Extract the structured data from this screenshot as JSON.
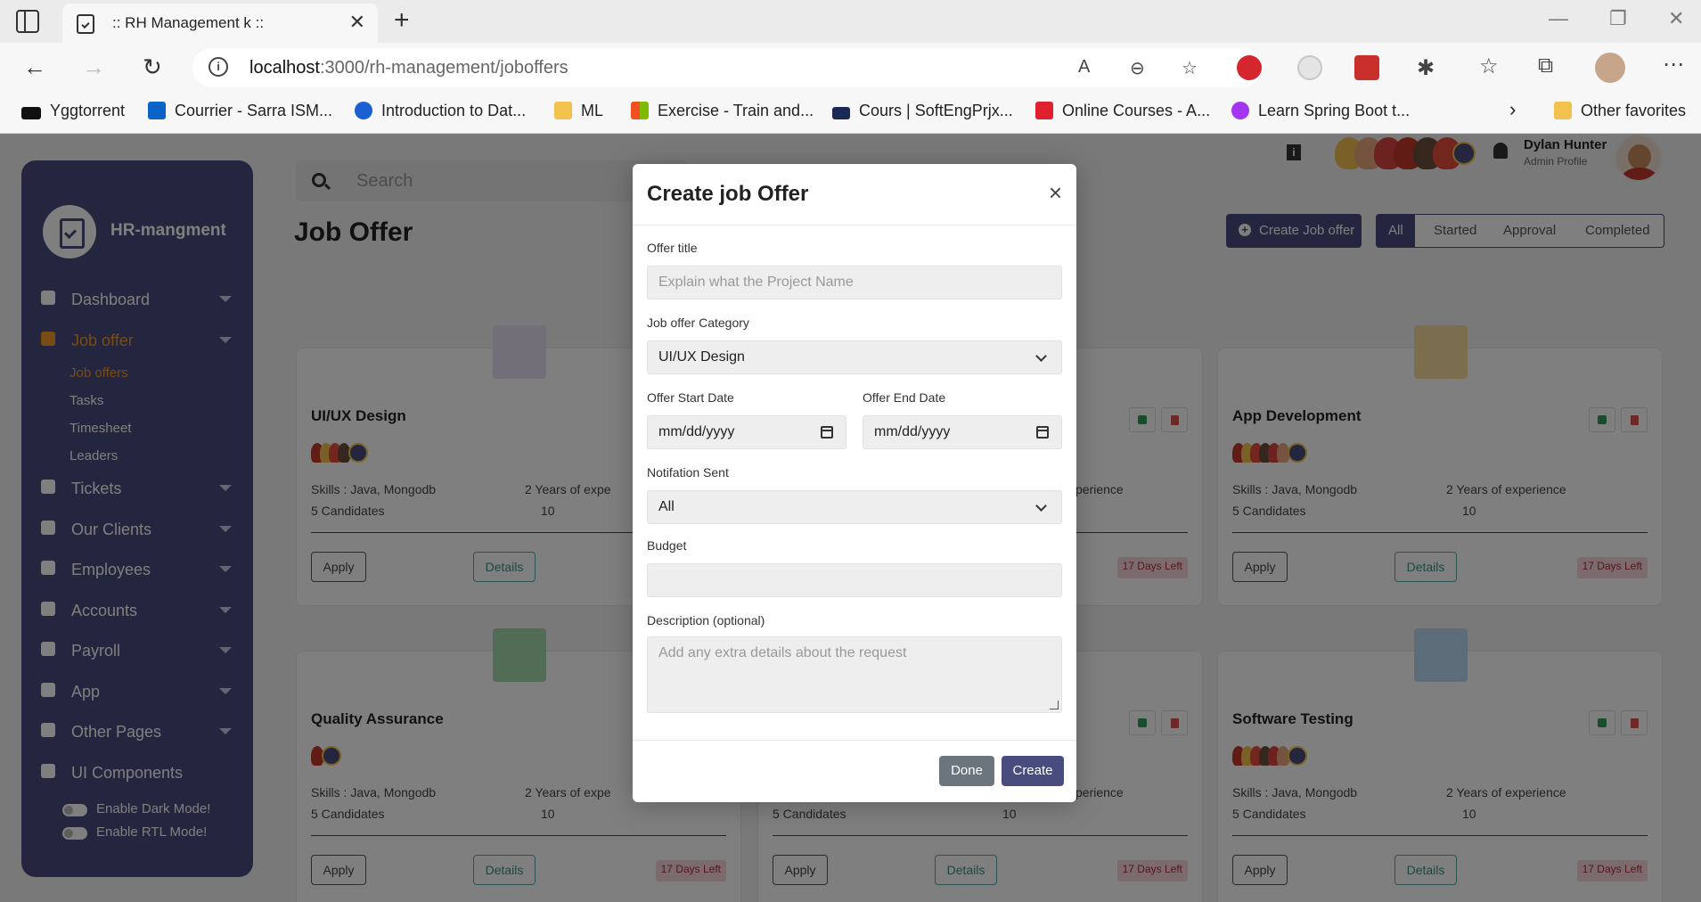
{
  "browser": {
    "tab_title": ":: RH Management k ::",
    "tab_close": "✕",
    "new_tab": "+",
    "url_host": "localhost",
    "url_path": ":3000/rh-management/joboffers",
    "bookmarks": [
      {
        "label": "Yggtorrent",
        "color": "#111111"
      },
      {
        "label": "Courrier - Sarra ISM...",
        "color": "#0a64c8"
      },
      {
        "label": "Introduction to Dat...",
        "color": "#1a5fd1"
      },
      {
        "label": "ML",
        "color": "#f2c14e"
      },
      {
        "label": "Exercise - Train and...",
        "color": "#f25022"
      },
      {
        "label": "Cours | SoftEngPrjx...",
        "color": "#1b2a55"
      },
      {
        "label": "Online Courses - A...",
        "color": "#e0202e"
      },
      {
        "label": "Learn Spring Boot t...",
        "color": "#a435f0"
      }
    ],
    "other_favorites": "Other favorites"
  },
  "sidebar": {
    "brand": "HR-mangment",
    "menu": [
      {
        "label": "Dashboard",
        "active": false
      },
      {
        "label": "Job offer",
        "active": true
      },
      {
        "label": "Tickets",
        "active": false
      },
      {
        "label": "Our Clients",
        "active": false
      },
      {
        "label": "Employees",
        "active": false
      },
      {
        "label": "Accounts",
        "active": false
      },
      {
        "label": "Payroll",
        "active": false
      },
      {
        "label": "App",
        "active": false
      },
      {
        "label": "Other Pages",
        "active": false
      },
      {
        "label": "UI Components",
        "active": false
      }
    ],
    "submenu": [
      {
        "label": "Job offers",
        "active": true
      },
      {
        "label": "Tasks",
        "active": false
      },
      {
        "label": "Timesheet",
        "active": false
      },
      {
        "label": "Leaders",
        "active": false
      }
    ],
    "toggles": [
      "Enable Dark Mode!",
      "Enable RTL Mode!"
    ]
  },
  "header": {
    "search_placeholder": "Search",
    "info_icon": "i",
    "user_name": "Dylan Hunter",
    "user_role": "Admin Profile"
  },
  "page": {
    "title": "Job Offer",
    "create_button": "Create Job offer",
    "filters": [
      "All",
      "Started",
      "Approval",
      "Completed"
    ]
  },
  "cards": [
    {
      "title": "UI/UX Design",
      "icon_color": "#e7dff0",
      "skills": "Skills : Java, Mongodb",
      "experience": "2 Years of expe",
      "candidates": "5 Candidates",
      "comments": "10",
      "apply": "Apply",
      "details": "Details",
      "days": "",
      "show_actions": false
    },
    {
      "title": "",
      "icon_color": "",
      "skills": "",
      "experience": "perience",
      "candidates": "",
      "comments": "",
      "apply": "",
      "details": "",
      "days": "17 Days Left",
      "show_actions": true
    },
    {
      "title": "App Development",
      "icon_color": "#f5dd9e",
      "skills": "Skills : Java, Mongodb",
      "experience": "2 Years of experience",
      "candidates": "5 Candidates",
      "comments": "10",
      "apply": "Apply",
      "details": "Details",
      "days": "17 Days Left",
      "show_actions": true
    },
    {
      "title": "Quality Assurance",
      "icon_color": "#a4d9ad",
      "skills": "Skills : Java, Mongodb",
      "experience": "2 Years of expe",
      "candidates": "5 Candidates",
      "comments": "10",
      "apply": "Apply",
      "details": "Details",
      "days": "17 Days Left",
      "show_actions": false
    },
    {
      "title": "",
      "icon_color": "",
      "skills": "",
      "experience": "perience",
      "candidates": "5 Candidates",
      "comments": "10",
      "apply": "Apply",
      "details": "Details",
      "days": "17 Days Left",
      "show_actions": true
    },
    {
      "title": "Software Testing",
      "icon_color": "#b9d8f2",
      "skills": "Skills : Java, Mongodb",
      "experience": "2 Years of experience",
      "candidates": "5 Candidates",
      "comments": "10",
      "apply": "Apply",
      "details": "Details",
      "days": "17 Days Left",
      "show_actions": true
    }
  ],
  "modal": {
    "title": "Create job Offer",
    "close": "×",
    "offer_title_label": "Offer title",
    "offer_title_placeholder": "Explain what the Project Name",
    "category_label": "Job offer Category",
    "category_value": "UI/UX Design",
    "start_label": "Offer Start Date",
    "start_placeholder": "mm/dd/yyyy",
    "end_label": "Offer End Date",
    "end_placeholder": "mm/dd/yyyy",
    "notification_label": "Notifation Sent",
    "notification_value": "All",
    "budget_label": "Budget",
    "description_label": "Description (optional)",
    "description_placeholder": "Add any extra details about the request",
    "done_button": "Done",
    "create_button": "Create"
  },
  "colors": {
    "primary": "#484c7f",
    "accent": "#f19828"
  }
}
